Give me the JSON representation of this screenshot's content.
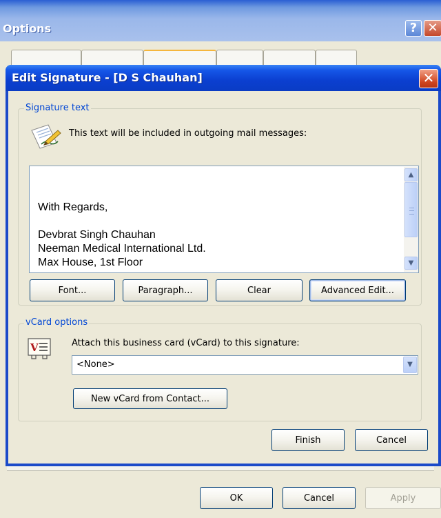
{
  "options_window": {
    "title": "Options",
    "help_glyph": "?",
    "close_glyph": "✕",
    "buttons": {
      "ok": "OK",
      "cancel": "Cancel",
      "apply": "Apply"
    }
  },
  "edit_signature": {
    "title": "Edit Signature - [D S Chauhan]",
    "close_glyph": "✕",
    "signature_group": {
      "legend": "Signature text",
      "description": "This text will be included in outgoing mail messages:",
      "icon": "pen-paper-icon",
      "text": "\nWith Regards,\n\nDevbrat Singh Chauhan\nNeeman Medical International Ltd.\nMax House, 1st Floor"
    },
    "buttons": {
      "font": "Font...",
      "paragraph": "Paragraph...",
      "clear": "Clear",
      "advanced_edit": "Advanced Edit..."
    },
    "vcard_group": {
      "legend": "vCard options",
      "attach_label": "Attach this business card (vCard) to this signature:",
      "icon": "vcard-icon",
      "selected": "<None>",
      "new_vcard_button": "New vCard from Contact..."
    },
    "footer": {
      "finish": "Finish",
      "cancel": "Cancel"
    }
  },
  "scroll_glyphs": {
    "up": "▲",
    "down": "▼",
    "dropdown": "▼"
  },
  "colors": {
    "xp_blue_title": "#0a3cc4",
    "xp_face": "#ece9d8",
    "group_legend": "#0046d5",
    "close_red": "#d0451f"
  }
}
